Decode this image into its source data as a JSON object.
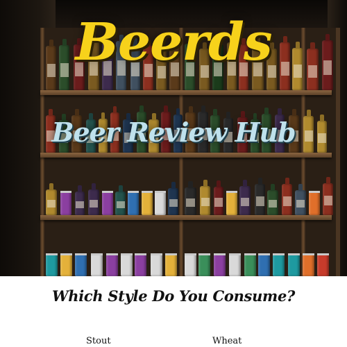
{
  "site": {
    "title": "Beerds",
    "subtitle": "Beer Review Hub"
  },
  "survey": {
    "question": "Which Style Do You Consume?",
    "options": [
      "Stout",
      "Wheat"
    ]
  },
  "colors": {
    "title": "#f7d21b",
    "subtitle": "#bfe1ec",
    "shelf_wood": "#8a6540"
  }
}
